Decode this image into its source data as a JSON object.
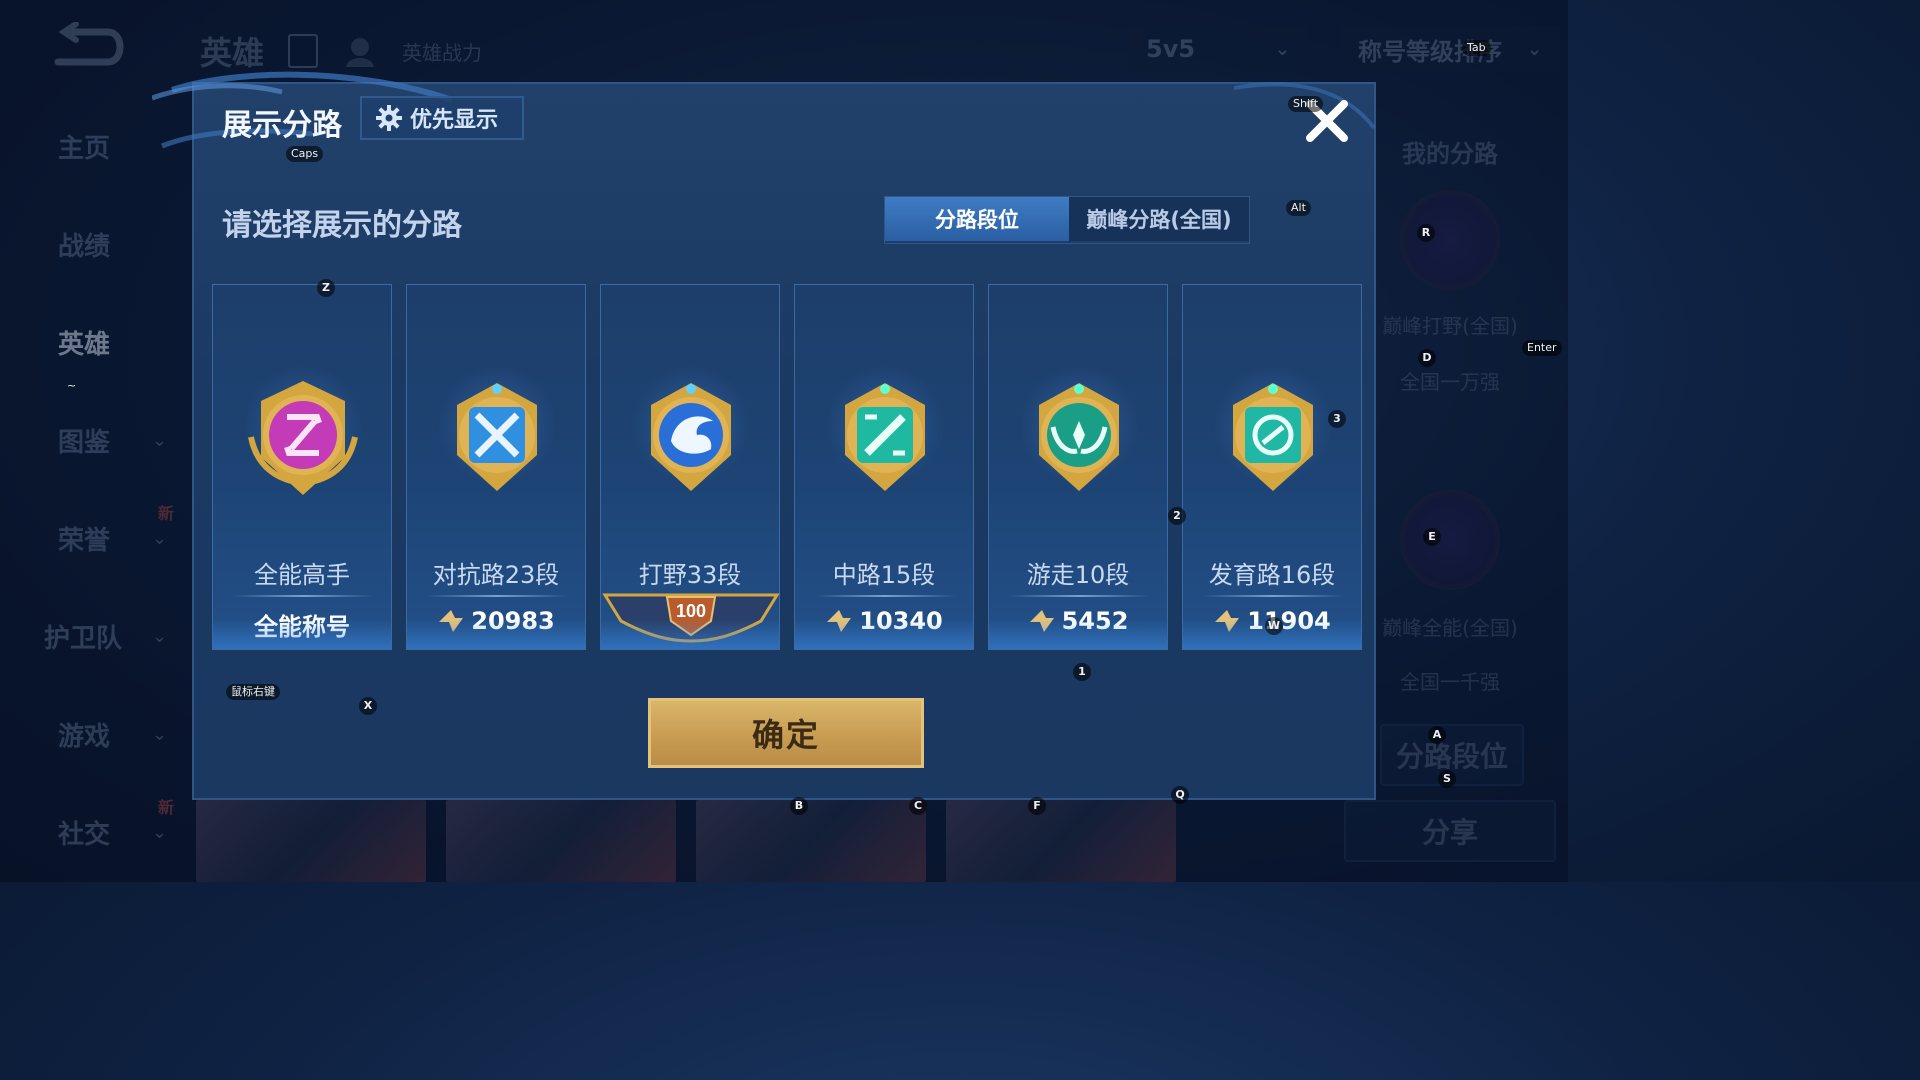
{
  "background": {
    "header_title": "英雄",
    "header_sub": "英雄战力",
    "mode_select": "5v5",
    "sort_select": "称号等级排序",
    "sidebar": [
      {
        "label": "主页",
        "chevron": false
      },
      {
        "label": "战绩",
        "chevron": false
      },
      {
        "label": "英雄",
        "chevron": false,
        "active": true
      },
      {
        "label": "图鉴",
        "chevron": true
      },
      {
        "label": "荣誉",
        "chevron": true,
        "badge": "新"
      },
      {
        "label": "护卫队",
        "chevron": true
      },
      {
        "label": "游戏",
        "chevron": true
      },
      {
        "label": "社交",
        "chevron": true,
        "badge": "新"
      }
    ],
    "right_panel": {
      "title": "我的分路",
      "emblem1_text": "巅峰打野(全国)",
      "emblem1_rank": "全国一万强",
      "emblem2_text": "巅峰全能(全国)",
      "emblem2_rank": "全国一千强",
      "lane_button": "分路段位",
      "share_button": "分享"
    }
  },
  "modal": {
    "title": "展示分路",
    "priority_button": "优先显示",
    "heading": "请选择展示的分路",
    "tabs": [
      {
        "label": "分路段位",
        "active": true
      },
      {
        "label": "巅峰分路(全国)",
        "active": false
      }
    ],
    "cards": [
      {
        "name": "全能高手",
        "value": "全能称号",
        "value_icon": false,
        "color": "#c33bb7"
      },
      {
        "name": "对抗路23段",
        "value": "20983",
        "value_icon": true,
        "color": "#2f8fe0"
      },
      {
        "name": "打野33段",
        "value": "100",
        "value_icon": false,
        "badge": true,
        "color": "#2a6fd8"
      },
      {
        "name": "中路15段",
        "value": "10340",
        "value_icon": true,
        "color": "#1fb8a0"
      },
      {
        "name": "游走10段",
        "value": "5452",
        "value_icon": true,
        "color": "#1a9f86"
      },
      {
        "name": "发育路16段",
        "value": "11904",
        "value_icon": true,
        "color": "#21b7a5"
      }
    ],
    "confirm_button": "确定"
  },
  "key_hints": {
    "caps": "Caps",
    "shift": "Shift",
    "tab": "Tab",
    "alt": "Alt",
    "enter": "Enter",
    "z": "Z",
    "x": "X",
    "r": "R",
    "d": "D",
    "e": "E",
    "a": "A",
    "s": "S",
    "b": "B",
    "c": "C",
    "f": "F",
    "q": "Q",
    "w": "W",
    "n1": "1",
    "n2": "2",
    "n3": "3",
    "tilde": "~",
    "rmb": "鼠标右键"
  }
}
